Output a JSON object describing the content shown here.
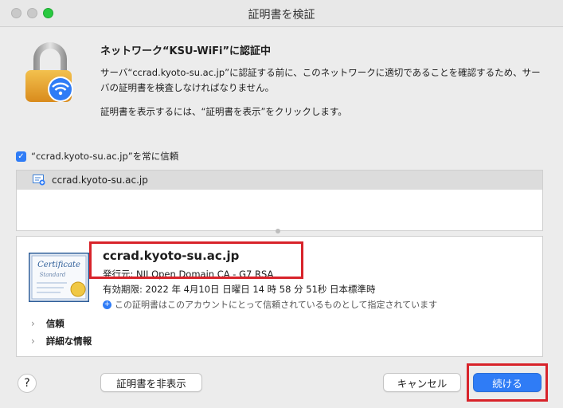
{
  "window": {
    "title": "証明書を検証"
  },
  "header": {
    "title": "ネットワーク“KSU-WiFi”に認証中"
  },
  "body": {
    "paragraph1": "サーバ“ccrad.kyoto-su.ac.jp”に認証する前に、このネットワークに適切であることを確認するため、サーバの証明書を検査しなければなりません。",
    "paragraph2": "証明書を表示するには、“証明書を表示”をクリックします。"
  },
  "trust_checkbox": {
    "label": "“ccrad.kyoto-su.ac.jp”を常に信頼",
    "checked": true
  },
  "chain": {
    "items": [
      {
        "label": "ccrad.kyoto-su.ac.jp"
      }
    ]
  },
  "certificate": {
    "image_text_1": "Certificate",
    "image_text_2": "Standard",
    "common_name": "ccrad.kyoto-su.ac.jp",
    "issuer": "発行元: NII Open Domain CA - G7 RSA",
    "expires": "有効期限: 2022 年 4月10日 日曜日 14 時 58 分 51秒 日本標準時",
    "status": "この証明書はこのアカウントにとって信頼されているものとして指定されています"
  },
  "sections": [
    {
      "label": "信頼"
    },
    {
      "label": "詳細な情報"
    }
  ],
  "buttons": {
    "help": "?",
    "hide_certificate": "証明書を非表示",
    "cancel": "キャンセル",
    "continue": "続ける"
  },
  "colors": {
    "accent": "#2f7cf6",
    "highlight": "#d8232a"
  }
}
